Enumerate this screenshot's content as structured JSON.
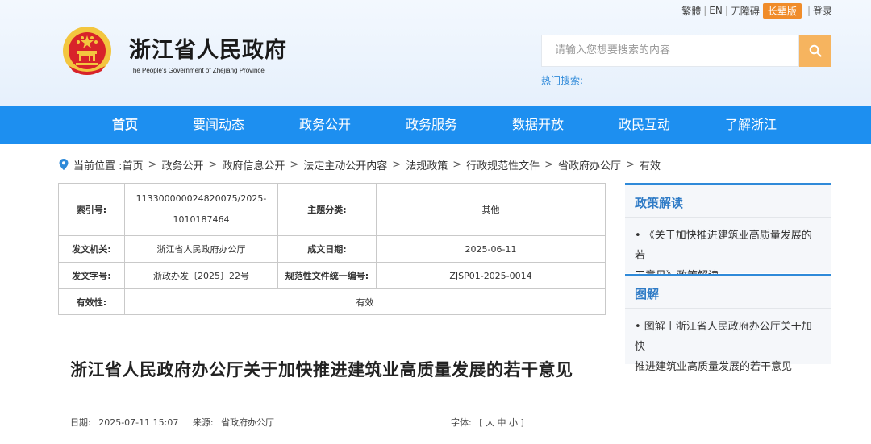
{
  "toplinks": {
    "traditional": "繁體",
    "english": "EN",
    "accessible": "无障碍",
    "elder": "长辈版",
    "login": "登录",
    "separator": "|"
  },
  "site": {
    "title": "浙江省人民政府",
    "subtitle": "The People's Government of Zhejiang Province"
  },
  "search": {
    "placeholder": "请输入您想要搜索的内容",
    "hot_label": "热门搜索:"
  },
  "nav": {
    "items": [
      "首页",
      "要闻动态",
      "政务公开",
      "政务服务",
      "数据开放",
      "政民互动",
      "了解浙江"
    ]
  },
  "breadcrumb": {
    "label": "当前位置 :",
    "items": [
      "首页",
      "政务公开",
      "政府信息公开",
      "法定主动公开内容",
      "法规政策",
      "行政规范性文件",
      "省政府办公厅",
      "有效"
    ],
    "separator": ">"
  },
  "info": {
    "index_key": "索引号:",
    "index_val_1": "113300000024820075/2025-",
    "index_val_2": "1010187464",
    "topic_key": "主题分类:",
    "topic_val": "其他",
    "issuer_key": "发文机关:",
    "issuer_val": "浙江省人民政府办公厅",
    "date_key": "成文日期:",
    "date_val": "2025-06-11",
    "doc_no_key": "发文字号:",
    "doc_no_val": "浙政办发〔2025〕22号",
    "code_key": "规范性文件统一编号:",
    "code_val": "ZJSP01-2025-0014",
    "validity_key": "有效性:",
    "validity_val": "有效"
  },
  "sidebar": {
    "policy_head": "政策解读",
    "policy_link_1": "• 《关于加快推进建筑业高质量发展的若",
    "policy_link_2": "干意见》政策解读",
    "graphic_head": "图解",
    "graphic_link_1": "• 图解丨浙江省人民政府办公厅关于加快",
    "graphic_link_2": "推进建筑业高质量发展的若干意见"
  },
  "article": {
    "title": "浙江省人民政府办公厅关于加快推进建筑业高质量发展的若干意见",
    "date_label": "日期:",
    "date": "2025-07-11 15:07",
    "source_label": "来源:",
    "source": "省政府办公厅",
    "font_label": "字体:",
    "font_open": "[",
    "font_large": "大",
    "font_medium": "中",
    "font_small": "小",
    "font_close": "]"
  },
  "colors": {
    "nav_bg": "#1d8ff0",
    "accent_orange": "#f08c2a",
    "search_btn": "#f6b45f",
    "link_blue": "#2f7bc6"
  }
}
